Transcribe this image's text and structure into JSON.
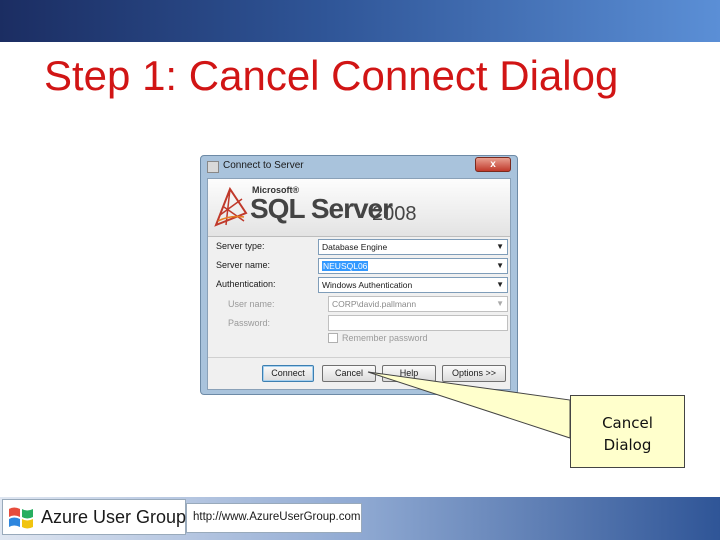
{
  "slide": {
    "title": "Step 1: Cancel Connect Dialog"
  },
  "dialog": {
    "title": "Connect to Server",
    "close_label": "x",
    "banner": {
      "company": "Microsoft®",
      "product": "SQL Server",
      "version": "2008"
    },
    "fields": {
      "server_type_label": "Server type:",
      "server_type_value": "Database Engine",
      "server_name_label": "Server name:",
      "server_name_value": "NEUSQL06",
      "authentication_label": "Authentication:",
      "authentication_value": "Windows Authentication",
      "user_name_label": "User name:",
      "user_name_value": "CORP\\david.pallmann",
      "password_label": "Password:",
      "password_value": ""
    },
    "remember_password_label": "Remember password",
    "buttons": {
      "connect": "Connect",
      "cancel": "Cancel",
      "help": "Help",
      "options": "Options >>"
    }
  },
  "callout": {
    "line1": "Cancel",
    "line2": "Dialog"
  },
  "footer": {
    "brand": "Azure User Group",
    "url": "http://www.AzureUserGroup.com"
  },
  "colors": {
    "title_red": "#d11515",
    "band_dark": "#1b2d62",
    "band_light": "#5b8fd6",
    "callout_fill": "#ffffcc",
    "selection_blue": "#3399ff"
  }
}
